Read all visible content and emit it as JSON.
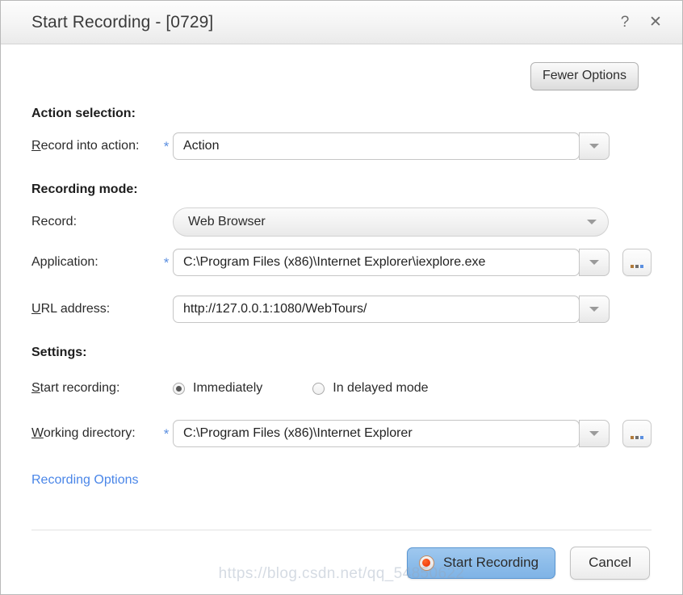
{
  "window": {
    "title": "Start Recording - [0729]",
    "help_icon": "question-mark-icon",
    "close_icon": "close-icon"
  },
  "toolbar": {
    "fewer_options_label": "Fewer Options"
  },
  "sections": {
    "action_selection": {
      "heading": "Action selection:",
      "record_into_action": {
        "label_accel": "R",
        "label_rest": "ecord into action:",
        "required_marker": "*",
        "value": "Action"
      }
    },
    "recording_mode": {
      "heading": "Recording mode:",
      "record": {
        "label": "Record:",
        "value": "Web Browser"
      },
      "application": {
        "label": "Application:",
        "required_marker": "*",
        "value": "C:\\Program Files (x86)\\Internet Explorer\\iexplore.exe",
        "browse_label": "..."
      },
      "url_address": {
        "label_accel": "U",
        "label_rest": "RL address:",
        "value": "http://127.0.0.1:1080/WebTours/"
      }
    },
    "settings": {
      "heading": "Settings:",
      "start_recording": {
        "label_accel": "S",
        "label_rest": "tart recording:",
        "options": [
          {
            "label": "Immediately",
            "selected": true
          },
          {
            "label": "In delayed mode",
            "selected": false
          }
        ]
      },
      "working_directory": {
        "label_accel": "W",
        "label_rest": "orking directory:",
        "required_marker": "*",
        "value": "C:\\Program Files (x86)\\Internet Explorer",
        "browse_label": "..."
      }
    }
  },
  "links": {
    "recording_options": "Recording Options"
  },
  "footer": {
    "start_recording_label": "Start Recording",
    "cancel_label": "Cancel",
    "record_icon": "record-dot-icon"
  },
  "watermark": "https://blog.csdn.net/qq_54850622",
  "colors": {
    "required_asterisk": "#5b8fe0",
    "link": "#4a86e8",
    "primary_button": "#8dbdea",
    "record_dot": "#f03c0c"
  }
}
